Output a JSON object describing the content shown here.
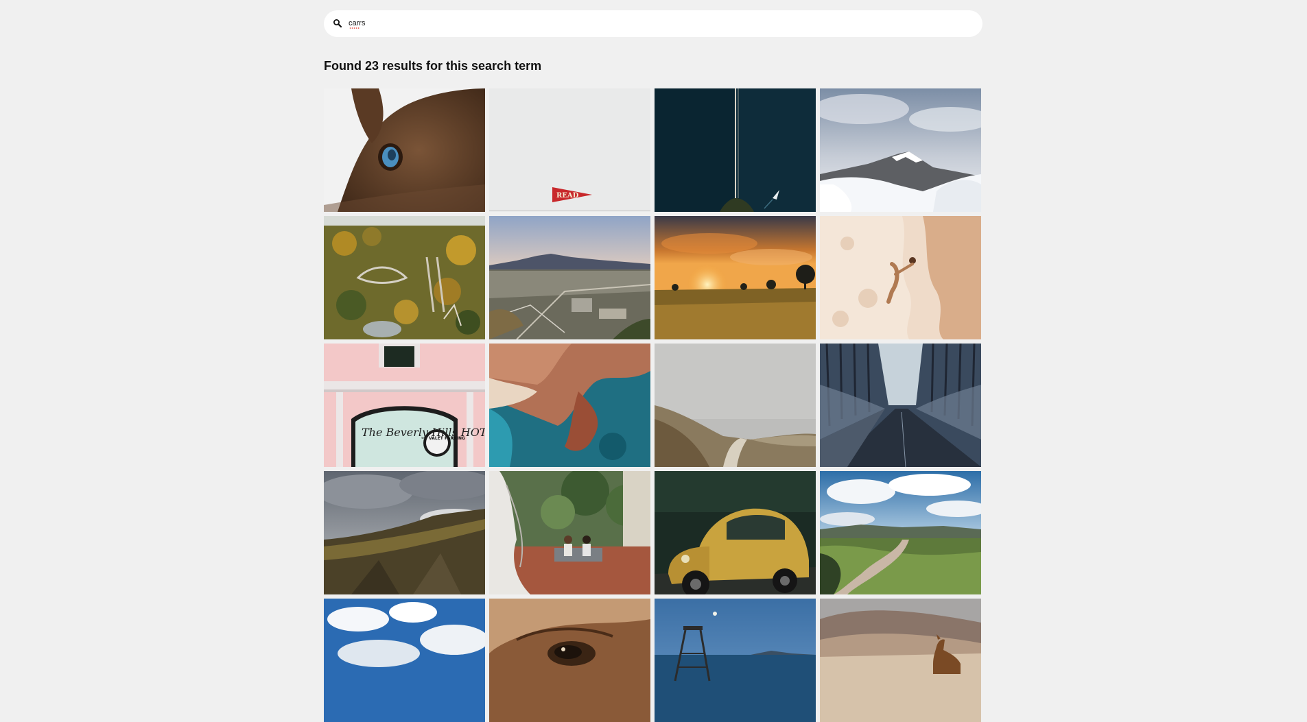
{
  "search": {
    "value": "carrs",
    "icon": "search-icon"
  },
  "results": {
    "title": "Found 23 results for this search term"
  },
  "photos": [
    {
      "subject": "camel-eye"
    },
    {
      "subject": "read-pennant",
      "text": "READ"
    },
    {
      "subject": "aerial-pier-boat"
    },
    {
      "subject": "snowy-volcano"
    },
    {
      "subject": "aerial-amusement-park"
    },
    {
      "subject": "aerial-town-mountain"
    },
    {
      "subject": "sunset-field"
    },
    {
      "subject": "beach-woman-waves"
    },
    {
      "subject": "beverly-hills-hotel-sign",
      "text": "The Beverly Hills HOTEL",
      "badge": "VALET PARKING"
    },
    {
      "subject": "aerial-rocky-coast"
    },
    {
      "subject": "foggy-hill-path"
    },
    {
      "subject": "forest-road"
    },
    {
      "subject": "cliff-cloudy-sky"
    },
    {
      "subject": "couple-on-bench"
    },
    {
      "subject": "yellow-beetle-car"
    },
    {
      "subject": "valley-river"
    },
    {
      "subject": "blue-sky-clouds"
    },
    {
      "subject": "horse-eye"
    },
    {
      "subject": "lifeguard-tower"
    },
    {
      "subject": "llama-desert"
    }
  ]
}
